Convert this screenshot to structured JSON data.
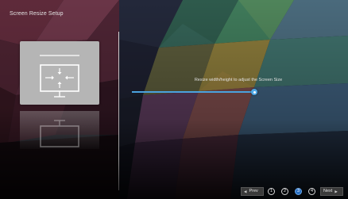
{
  "page": {
    "title": "Screen Resize Setup",
    "instruction": "Resize width/height to adjust the Screen Size"
  },
  "slider": {
    "value_fraction": 0.95,
    "accent_color": "#4aa2de"
  },
  "illustration": {
    "icon": "tv-resize-icon"
  },
  "navigation": {
    "prev_label": "Prev",
    "next_label": "Next",
    "steps": [
      "1",
      "2",
      "3",
      "4"
    ],
    "active_step": "3"
  },
  "colors": {
    "accent": "#2a6fc2",
    "background": "#1a1c25",
    "text": "#e3e3e3"
  }
}
